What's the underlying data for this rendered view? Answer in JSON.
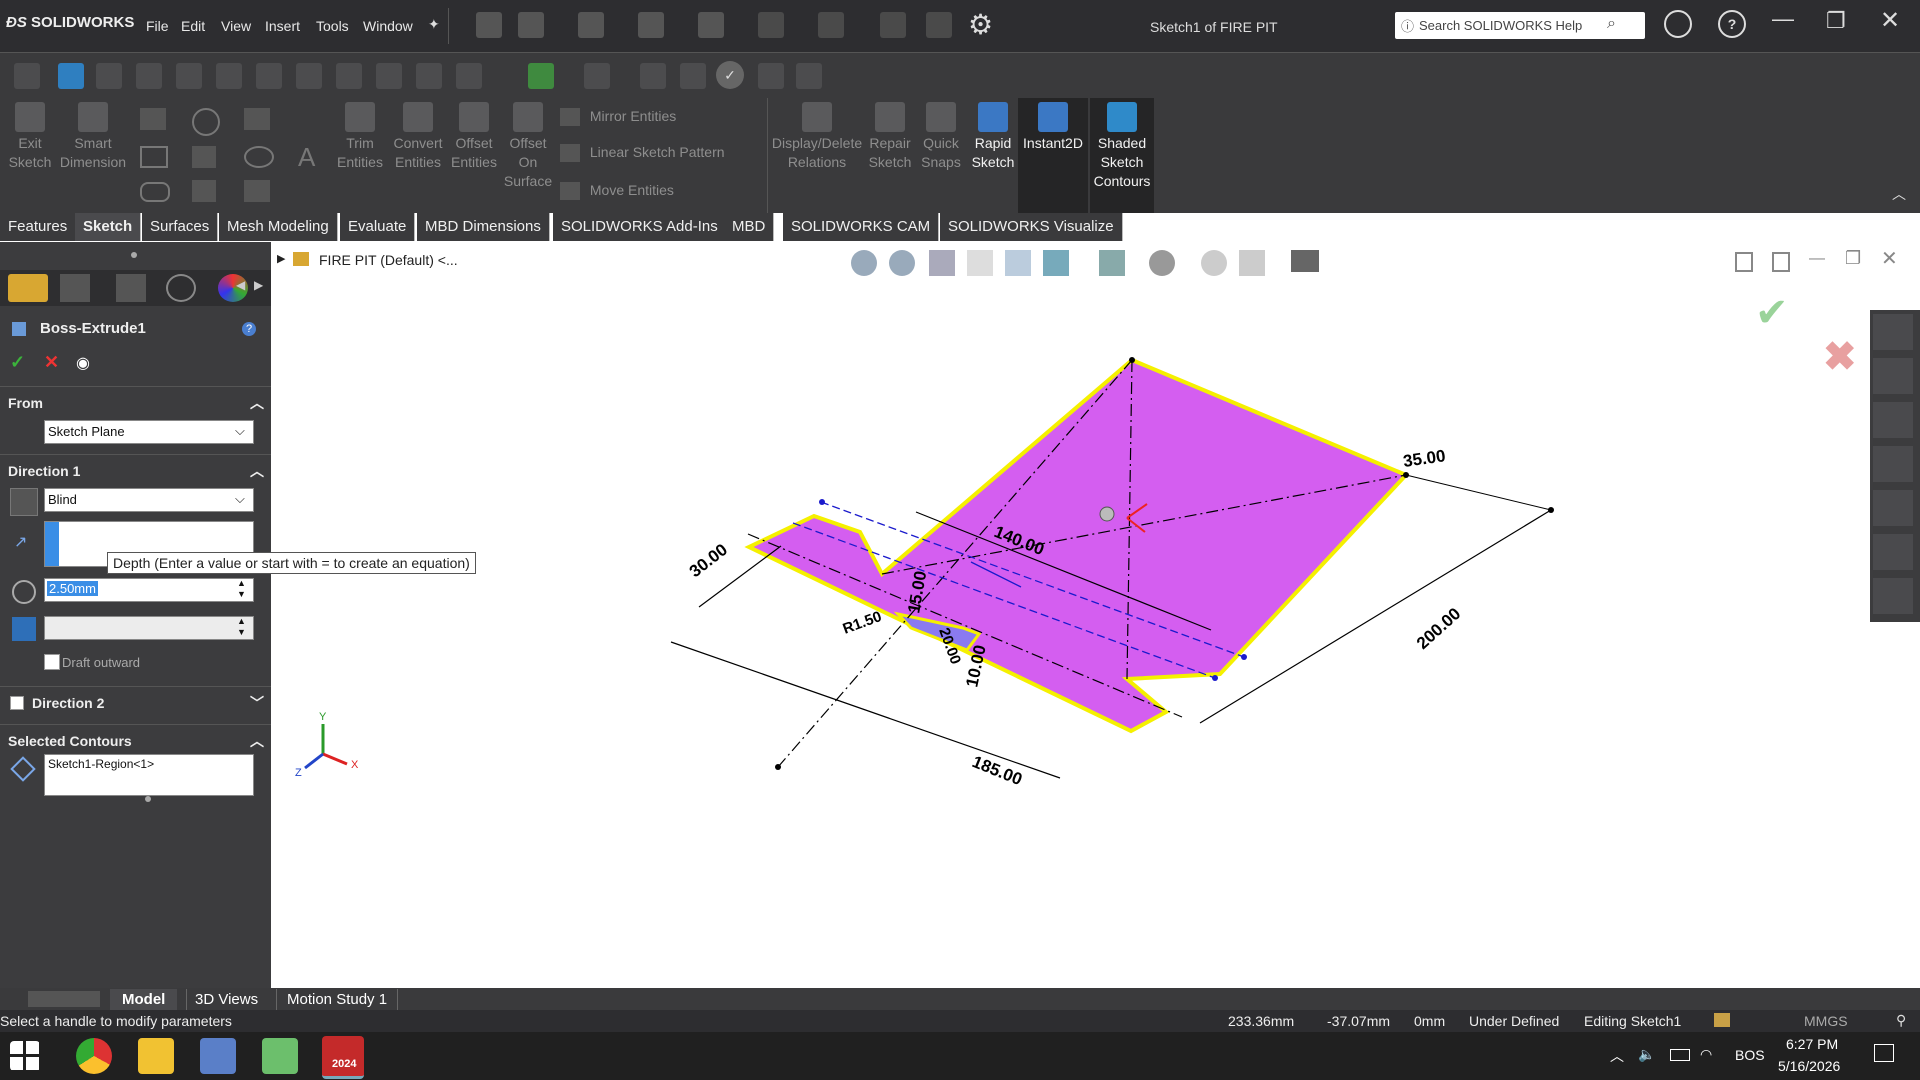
{
  "app": {
    "logo_text": "SOLIDWORKS",
    "window_title": "Sketch1 of FIRE PIT",
    "search_placeholder": "Search SOLIDWORKS Help"
  },
  "menu": [
    "File",
    "Edit",
    "View",
    "Insert",
    "Tools",
    "Window"
  ],
  "command_manager": {
    "exit_sketch": [
      "Exit",
      "Sketch"
    ],
    "smart_dimension": [
      "Smart",
      "Dimension"
    ],
    "trim": [
      "Trim",
      "Entities"
    ],
    "convert": [
      "Convert",
      "Entities"
    ],
    "offset": [
      "Offset",
      "Entities"
    ],
    "offset_surface": [
      "Offset",
      "On",
      "Surface"
    ],
    "mirror": "Mirror Entities",
    "linear_pattern": "Linear Sketch Pattern",
    "move": "Move Entities",
    "display_delete": [
      "Display/Delete",
      "Relations"
    ],
    "repair": [
      "Repair",
      "Sketch"
    ],
    "quick_snaps": [
      "Quick",
      "Snaps"
    ],
    "rapid_sketch": [
      "Rapid",
      "Sketch"
    ],
    "instant2d": "Instant2D",
    "shaded_contours": [
      "Shaded",
      "Sketch",
      "Contours"
    ]
  },
  "tabs": [
    "Features",
    "Sketch",
    "Surfaces",
    "Mesh Modeling",
    "Evaluate",
    "MBD Dimensions",
    "SOLIDWORKS Add-Ins",
    "MBD",
    "SOLIDWORKS CAM",
    "SOLIDWORKS Visualize"
  ],
  "feature_tree_title": "FIRE PIT  (Default) <...",
  "property_manager": {
    "title": "Boss-Extrude1",
    "from_label": "From",
    "from_value": "Sketch Plane",
    "direction1_label": "Direction 1",
    "end_condition": "Blind",
    "tooltip": "Depth (Enter a value or start with = to create an equation)",
    "depth_value": "2.50mm",
    "draft_label": "Draft outward",
    "direction2_label": "Direction 2",
    "selected_contours_label": "Selected Contours",
    "selected_contour_item": "Sketch1-Region<1>"
  },
  "dimensions": {
    "d1": "35.00",
    "d2": "140.00",
    "d3": "200.00",
    "d4": "185.00",
    "d5": "30.00",
    "d6": "15.00",
    "d7": "10.00",
    "d8": "R1.50",
    "d9": "20.00"
  },
  "triad": {
    "x": "X",
    "y": "Y",
    "z": "Z"
  },
  "bottom_tabs": [
    "Model",
    "3D Views",
    "Motion Study 1"
  ],
  "status": {
    "message": "Select a handle to modify parameters",
    "x": "233.36mm",
    "y": "-37.07mm",
    "z": "0mm",
    "state": "Under Defined",
    "editing": "Editing Sketch1",
    "units": "MMGS"
  },
  "taskbar": {
    "lang": "BOS",
    "time": "6:27 PM",
    "date": "5/16/2026",
    "sw_badge": "2024"
  },
  "colors": {
    "magenta_region": "#d45ef0",
    "outline_yellow": "#f5f000",
    "sketch_blue": "#1a1acc"
  }
}
